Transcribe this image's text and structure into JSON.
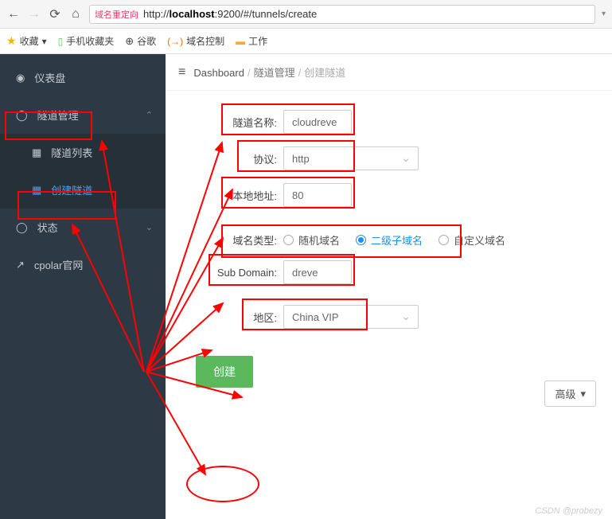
{
  "browser": {
    "redirect_tag": "域名重定向",
    "url_prefix": "http://",
    "url_host": "localhost",
    "url_rest": ":9200/#/tunnels/create"
  },
  "bookmarks": {
    "fav": "收藏",
    "mobile": "手机收藏夹",
    "google": "谷歌",
    "domain": "域名控制",
    "work": "工作"
  },
  "sidebar": {
    "dashboard": "仪表盘",
    "tunnel_mgmt": "隧道管理",
    "tunnel_list": "隧道列表",
    "tunnel_create": "创建隧道",
    "status": "状态",
    "official": "cpolar官网"
  },
  "breadcrumb": {
    "dash": "Dashboard",
    "mgmt": "隧道管理",
    "create": "创建隧道"
  },
  "form": {
    "name_label": "隧道名称:",
    "name_value": "cloudreve",
    "proto_label": "协议:",
    "proto_value": "http",
    "addr_label": "本地地址:",
    "addr_value": "80",
    "domain_type_label": "域名类型:",
    "domain_random": "随机域名",
    "domain_sub": "二级子域名",
    "domain_custom": "自定义域名",
    "subdomain_label": "Sub Domain:",
    "subdomain_value": "dreve",
    "region_label": "地区:",
    "region_value": "China VIP",
    "advanced": "高级",
    "submit": "创建"
  },
  "watermark": "CSDN @probezy"
}
